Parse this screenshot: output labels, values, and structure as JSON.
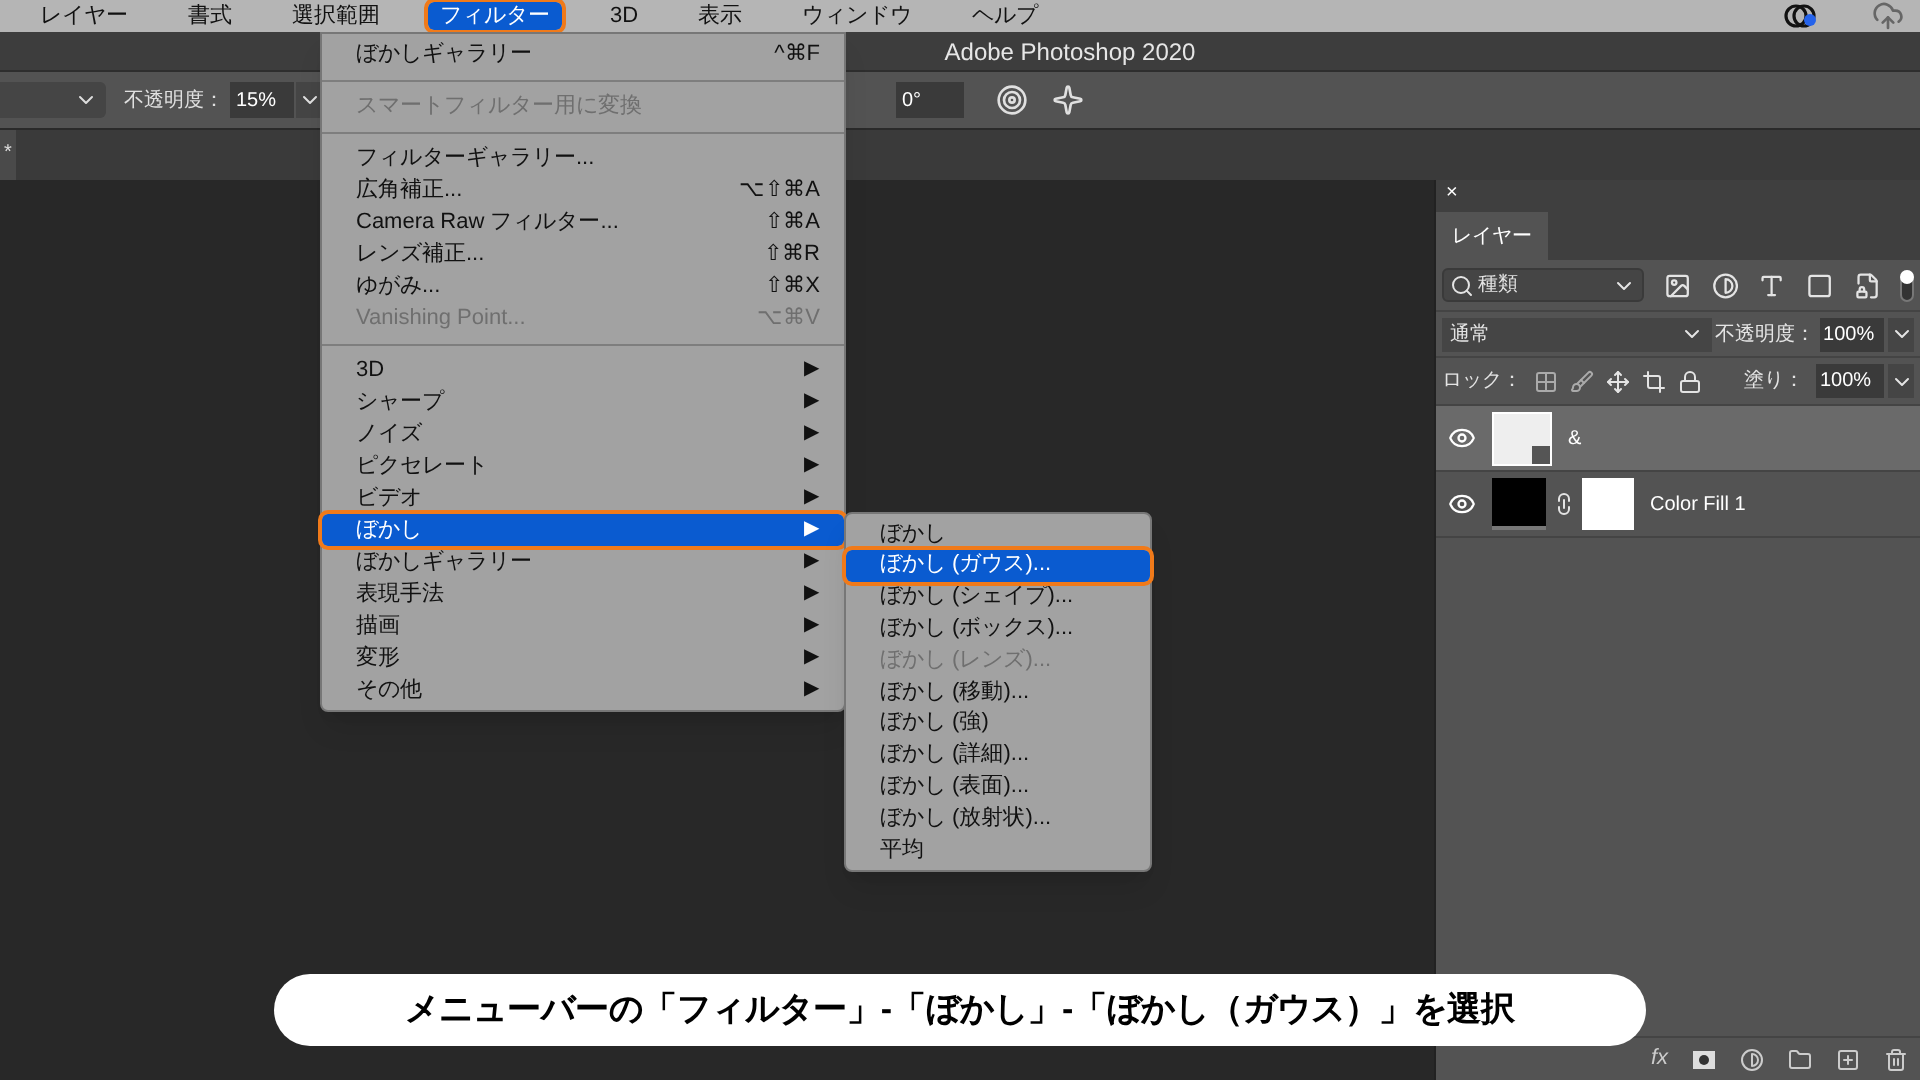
{
  "menu_bar": {
    "items": [
      {
        "label": "レイヤー",
        "selected": false,
        "annotated": false
      },
      {
        "label": "書式",
        "selected": false,
        "annotated": false
      },
      {
        "label": "選択範囲",
        "selected": false,
        "annotated": false
      },
      {
        "label": "フィルター",
        "selected": true,
        "annotated": true
      },
      {
        "label": "3D",
        "selected": false,
        "annotated": false
      },
      {
        "label": "表示",
        "selected": false,
        "annotated": false
      },
      {
        "label": "ウィンドウ",
        "selected": false,
        "annotated": false
      },
      {
        "label": "ヘルプ",
        "selected": false,
        "annotated": false
      }
    ]
  },
  "title_bar": {
    "title": "Adobe Photoshop 2020"
  },
  "options_bar": {
    "opacity_label": "不透明度：",
    "opacity_value": "15%",
    "angle_value": "0°"
  },
  "document_tab": {
    "label": "*"
  },
  "filter_menu": {
    "items": [
      {
        "kind": "item",
        "label": "ぼかしギャラリー",
        "shortcut": "^⌘F",
        "disabled": false,
        "selected": false,
        "annotated": false
      },
      {
        "kind": "separator"
      },
      {
        "kind": "item",
        "label": "スマートフィルター用に変換",
        "disabled": true,
        "selected": false,
        "annotated": false
      },
      {
        "kind": "separator"
      },
      {
        "kind": "item",
        "label": "フィルターギャラリー...",
        "disabled": false,
        "selected": false,
        "annotated": false
      },
      {
        "kind": "item",
        "label": "広角補正...",
        "shortcut": "⌥⇧⌘A",
        "disabled": false,
        "selected": false,
        "annotated": false
      },
      {
        "kind": "item",
        "label": "Camera Raw フィルター...",
        "shortcut": "⇧⌘A",
        "disabled": false,
        "selected": false,
        "annotated": false
      },
      {
        "kind": "item",
        "label": "レンズ補正...",
        "shortcut": "⇧⌘R",
        "disabled": false,
        "selected": false,
        "annotated": false
      },
      {
        "kind": "item",
        "label": "ゆがみ...",
        "shortcut": "⇧⌘X",
        "disabled": false,
        "selected": false,
        "annotated": false
      },
      {
        "kind": "item",
        "label": "Vanishing Point...",
        "shortcut": "⌥⌘V",
        "disabled": true,
        "selected": false,
        "annotated": false
      },
      {
        "kind": "separator"
      },
      {
        "kind": "item",
        "label": "3D",
        "arrow": "▶",
        "disabled": false,
        "selected": false,
        "annotated": false
      },
      {
        "kind": "item",
        "label": "シャープ",
        "arrow": "▶",
        "disabled": false,
        "selected": false,
        "annotated": false
      },
      {
        "kind": "item",
        "label": "ノイズ",
        "arrow": "▶",
        "disabled": false,
        "selected": false,
        "annotated": false
      },
      {
        "kind": "item",
        "label": "ピクセレート",
        "arrow": "▶",
        "disabled": false,
        "selected": false,
        "annotated": false
      },
      {
        "kind": "item",
        "label": "ビデオ",
        "arrow": "▶",
        "disabled": false,
        "selected": false,
        "annotated": false
      },
      {
        "kind": "item",
        "label": "ぼかし",
        "arrow": "▶",
        "disabled": false,
        "selected": true,
        "annotated": true
      },
      {
        "kind": "item",
        "label": "ぼかしギャラリー",
        "arrow": "▶",
        "disabled": false,
        "selected": false,
        "annotated": false
      },
      {
        "kind": "item",
        "label": "表現手法",
        "arrow": "▶",
        "disabled": false,
        "selected": false,
        "annotated": false
      },
      {
        "kind": "item",
        "label": "描画",
        "arrow": "▶",
        "disabled": false,
        "selected": false,
        "annotated": false
      },
      {
        "kind": "item",
        "label": "変形",
        "arrow": "▶",
        "disabled": false,
        "selected": false,
        "annotated": false
      },
      {
        "kind": "item",
        "label": "その他",
        "arrow": "▶",
        "disabled": false,
        "selected": false,
        "annotated": false
      }
    ]
  },
  "blur_submenu": {
    "items": [
      {
        "label": "ぼかし",
        "disabled": false,
        "selected": false,
        "annotated": false
      },
      {
        "label": "ぼかし (ガウス)...",
        "disabled": false,
        "selected": true,
        "annotated": true
      },
      {
        "label": "ぼかし (シェイプ)...",
        "disabled": false,
        "selected": false,
        "annotated": false
      },
      {
        "label": "ぼかし (ボックス)...",
        "disabled": false,
        "selected": false,
        "annotated": false
      },
      {
        "label": "ぼかし (レンズ)...",
        "disabled": true,
        "selected": false,
        "annotated": false
      },
      {
        "label": "ぼかし (移動)...",
        "disabled": false,
        "selected": false,
        "annotated": false
      },
      {
        "label": "ぼかし (強)",
        "disabled": false,
        "selected": false,
        "annotated": false
      },
      {
        "label": "ぼかし (詳細)...",
        "disabled": false,
        "selected": false,
        "annotated": false
      },
      {
        "label": "ぼかし (表面)...",
        "disabled": false,
        "selected": false,
        "annotated": false
      },
      {
        "label": "ぼかし (放射状)...",
        "disabled": false,
        "selected": false,
        "annotated": false
      },
      {
        "label": "平均",
        "disabled": false,
        "selected": false,
        "annotated": false
      }
    ]
  },
  "layers_panel": {
    "close": "×",
    "tab": "レイヤー",
    "filter_value": "種類",
    "blend_mode": "通常",
    "opacity_label": "不透明度：",
    "opacity_value": "100%",
    "lock_label": "ロック：",
    "fill_label": "塗り：",
    "fill_value": "100%",
    "fx": "fx",
    "layers": [
      {
        "name": "&",
        "kind": "smart",
        "visible": true,
        "selected": true
      },
      {
        "name": "Color Fill 1",
        "kind": "fill",
        "visible": true,
        "selected": false
      }
    ]
  },
  "caption": "メニューバーの「フィルター」-「ぼかし」-「ぼかし（ガウス）」を選択"
}
